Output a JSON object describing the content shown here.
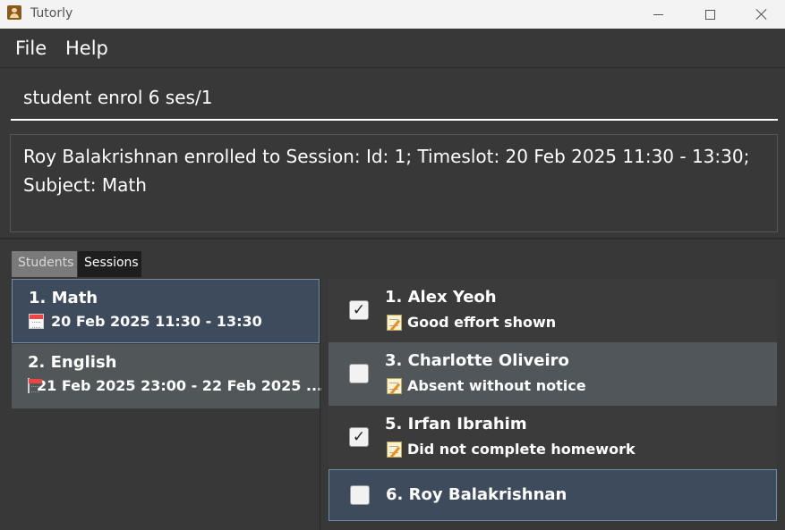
{
  "window": {
    "title": "Tutorly",
    "icons": [
      "app-icon",
      "minimize-icon",
      "maximize-icon",
      "close-icon"
    ]
  },
  "menu": {
    "file": "File",
    "help": "Help"
  },
  "command": {
    "value": "student enrol 6 ses/1"
  },
  "result": {
    "text": "Roy Balakrishnan enrolled to Session: Id: 1; Timeslot: 20 Feb 2025 11:30 - 13:30; Subject: Math"
  },
  "tabs": {
    "students": "Students",
    "sessions": "Sessions"
  },
  "sessions": [
    {
      "title": "1. Math",
      "timeslot": "20 Feb 2025 11:30 - 13:30",
      "icon": "calendar-icon"
    },
    {
      "title": "2. English",
      "timeslot": "21 Feb 2025 23:00 - 22 Feb 2025 ...",
      "icon": "calendar-icon"
    }
  ],
  "attendance": [
    {
      "name": "1. Alex Yeoh",
      "checked": true,
      "note": "Good effort shown",
      "icon": "memo-icon"
    },
    {
      "name": "3. Charlotte Oliveiro",
      "checked": false,
      "note": "Absent without notice",
      "icon": "memo-icon"
    },
    {
      "name": "5. Irfan Ibrahim",
      "checked": true,
      "note": "Did not complete homework",
      "icon": "memo-icon"
    },
    {
      "name": "6. Roy Balakrishnan",
      "checked": false,
      "note": ""
    }
  ],
  "colors": {
    "background": "#383838",
    "selected": "#3e4b5c",
    "selected_border": "#6e8ea8",
    "row_alt": "#51565a"
  }
}
